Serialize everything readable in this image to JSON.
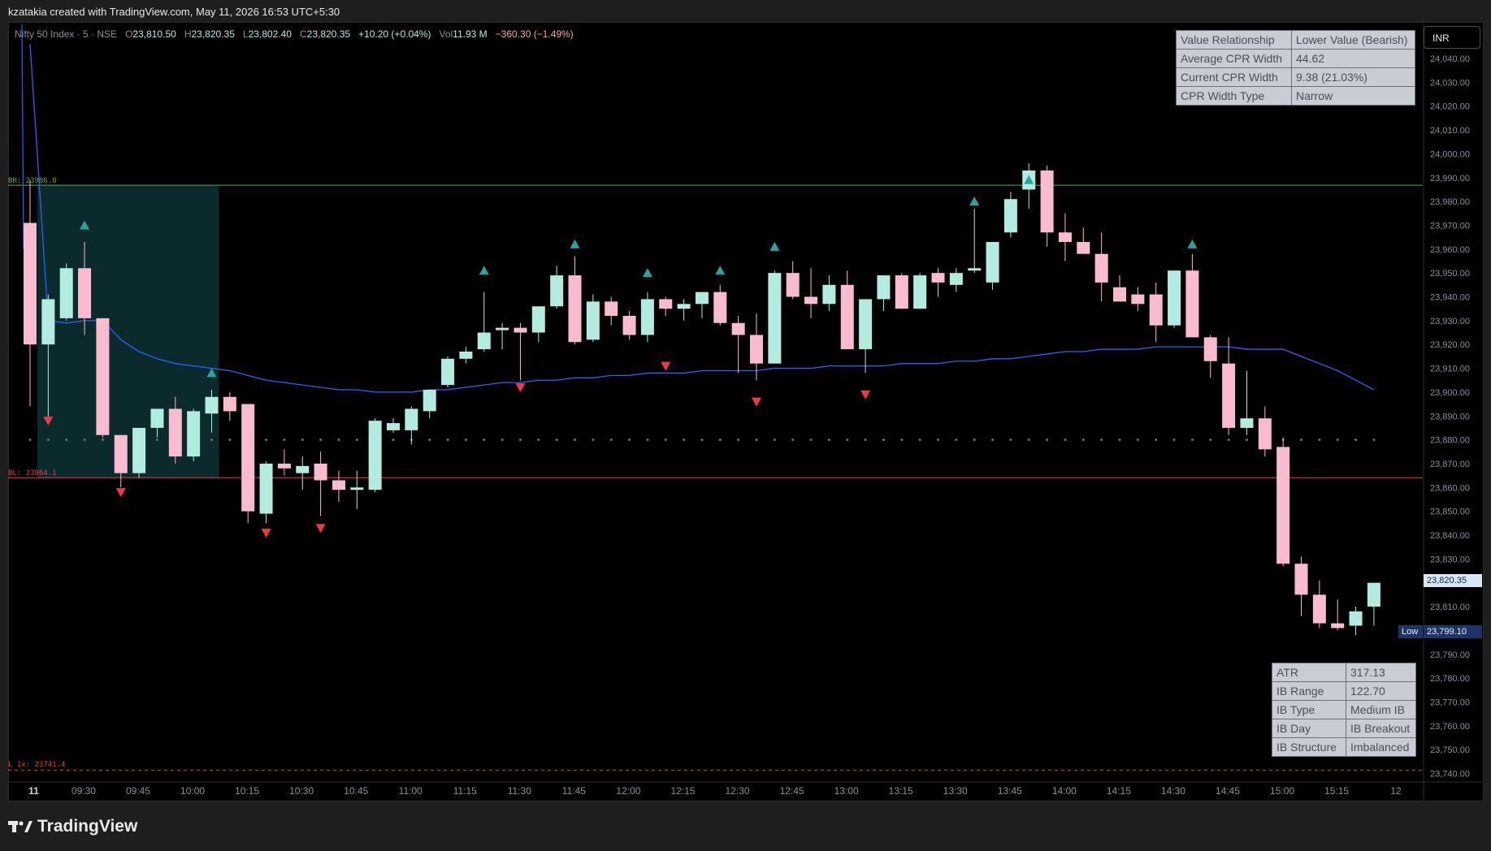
{
  "header": {
    "attribution": "kzatakia created with TradingView.com, May 11, 2026 16:53 UTC+5:30"
  },
  "legend": {
    "symbol": "Nifty 50 Index · 5 · NSE",
    "open_label": "O",
    "open": "23,810.50",
    "high_label": "H",
    "high": "23,820.35",
    "low_label": "L",
    "low": "23,802.40",
    "close_label": "C",
    "close": "23,820.35",
    "change": "+10.20 (+0.04%)",
    "vol_label": "Vol",
    "vol": "11.93 M",
    "vol_change": "−360.30 (−1.49%)"
  },
  "currency": "INR",
  "last_price_tag": "23,820.35",
  "low_tag": {
    "label": "Low",
    "value": "23,799.10"
  },
  "level_labels": {
    "bh": "BH: 23986.8",
    "bl": "BL: 23864.1",
    "l1x": "L 1x: 23741.4"
  },
  "cpr_table": [
    {
      "key": "Value Relationship",
      "value": "Lower Value (Bearish)"
    },
    {
      "key": "Average CPR Width",
      "value": "44.62"
    },
    {
      "key": "Current CPR Width",
      "value": "9.38 (21.03%)"
    },
    {
      "key": "CPR Width Type",
      "value": "Narrow"
    }
  ],
  "ib_table": [
    {
      "key": "ATR",
      "value": "317.13"
    },
    {
      "key": "IB Range",
      "value": "122.70"
    },
    {
      "key": "IB Type",
      "value": "Medium IB"
    },
    {
      "key": "IB Day",
      "value": "IB Breakout"
    },
    {
      "key": "IB Structure",
      "value": "Imbalanced"
    }
  ],
  "brand": "TradingView",
  "colors": {
    "up": "#b2ebe0",
    "down": "#f8bbd0",
    "signal_up": "#26a69a",
    "signal_down": "#f23645",
    "ma_line": "#2962ff",
    "bh_line": "#4caf50",
    "bl_line": "#f23645",
    "ib_zone": "#0a2a2c",
    "pivot_dots": "#6b7078",
    "axis_text": "#8a8e97"
  },
  "chart_data": {
    "type": "candlestick",
    "interval": "5",
    "x_tick_labels": [
      "11",
      "09:30",
      "09:45",
      "10:00",
      "10:15",
      "10:30",
      "10:45",
      "11:00",
      "11:15",
      "11:30",
      "11:45",
      "12:00",
      "12:15",
      "12:30",
      "12:45",
      "13:00",
      "13:15",
      "13:30",
      "13:45",
      "14:00",
      "14:15",
      "14:30",
      "14:45",
      "15:00",
      "15:15",
      "12"
    ],
    "y_range": [
      23735,
      24046
    ],
    "y_ticks": [
      24040,
      24030,
      24020,
      24010,
      24000,
      23990,
      23980,
      23970,
      23960,
      23950,
      23940,
      23930,
      23920,
      23910,
      23900,
      23890,
      23880,
      23870,
      23860,
      23850,
      23840,
      23830,
      23820,
      23810,
      23800,
      23790,
      23780,
      23770,
      23760,
      23750,
      23740
    ],
    "candles": [
      {
        "o": 23971,
        "h": 23989,
        "l": 23894,
        "c": 23920
      },
      {
        "o": 23920,
        "h": 23941,
        "l": 23889,
        "c": 23939
      },
      {
        "o": 23931,
        "h": 23954,
        "l": 23930,
        "c": 23952
      },
      {
        "o": 23952,
        "h": 23963,
        "l": 23924,
        "c": 23931
      },
      {
        "o": 23931,
        "h": 23931,
        "l": 23881,
        "c": 23882
      },
      {
        "o": 23882,
        "h": 23882,
        "l": 23860,
        "c": 23866
      },
      {
        "o": 23866,
        "h": 23885,
        "l": 23864,
        "c": 23885
      },
      {
        "o": 23885,
        "h": 23893,
        "l": 23881,
        "c": 23893
      },
      {
        "o": 23893,
        "h": 23898,
        "l": 23870,
        "c": 23873
      },
      {
        "o": 23873,
        "h": 23893,
        "l": 23871,
        "c": 23892
      },
      {
        "o": 23891,
        "h": 23901,
        "l": 23883,
        "c": 23898
      },
      {
        "o": 23898,
        "h": 23900,
        "l": 23888,
        "c": 23892
      },
      {
        "o": 23895,
        "h": 23895,
        "l": 23845,
        "c": 23850
      },
      {
        "o": 23849,
        "h": 23871,
        "l": 23845,
        "c": 23870
      },
      {
        "o": 23870,
        "h": 23876,
        "l": 23865,
        "c": 23868
      },
      {
        "o": 23866,
        "h": 23873,
        "l": 23859,
        "c": 23869
      },
      {
        "o": 23870,
        "h": 23875,
        "l": 23848,
        "c": 23863
      },
      {
        "o": 23863,
        "h": 23867,
        "l": 23854,
        "c": 23859
      },
      {
        "o": 23859,
        "h": 23867,
        "l": 23851,
        "c": 23860
      },
      {
        "o": 23859,
        "h": 23889,
        "l": 23858,
        "c": 23888
      },
      {
        "o": 23884,
        "h": 23889,
        "l": 23883,
        "c": 23887
      },
      {
        "o": 23884,
        "h": 23894,
        "l": 23878,
        "c": 23893
      },
      {
        "o": 23892,
        "h": 23901,
        "l": 23889,
        "c": 23901
      },
      {
        "o": 23903,
        "h": 23915,
        "l": 23902,
        "c": 23914
      },
      {
        "o": 23914,
        "h": 23919,
        "l": 23912,
        "c": 23917
      },
      {
        "o": 23918,
        "h": 23942,
        "l": 23917,
        "c": 23925
      },
      {
        "o": 23926,
        "h": 23929,
        "l": 23918,
        "c": 23927
      },
      {
        "o": 23927,
        "h": 23929,
        "l": 23905,
        "c": 23925
      },
      {
        "o": 23925,
        "h": 23930,
        "l": 23921,
        "c": 23936
      },
      {
        "o": 23936,
        "h": 23953,
        "l": 23935,
        "c": 23949
      },
      {
        "o": 23949,
        "h": 23957,
        "l": 23920,
        "c": 23921
      },
      {
        "o": 23922,
        "h": 23941,
        "l": 23921,
        "c": 23938
      },
      {
        "o": 23938,
        "h": 23940,
        "l": 23928,
        "c": 23932
      },
      {
        "o": 23932,
        "h": 23934,
        "l": 23922,
        "c": 23924
      },
      {
        "o": 23924,
        "h": 23942,
        "l": 23921,
        "c": 23939
      },
      {
        "o": 23939,
        "h": 23940,
        "l": 23932,
        "c": 23935
      },
      {
        "o": 23935,
        "h": 23939,
        "l": 23930,
        "c": 23937
      },
      {
        "o": 23937,
        "h": 23942,
        "l": 23931,
        "c": 23942
      },
      {
        "o": 23942,
        "h": 23945,
        "l": 23928,
        "c": 23929
      },
      {
        "o": 23929,
        "h": 23932,
        "l": 23908,
        "c": 23924
      },
      {
        "o": 23924,
        "h": 23933,
        "l": 23905,
        "c": 23912
      },
      {
        "o": 23912,
        "h": 23951,
        "l": 23912,
        "c": 23950
      },
      {
        "o": 23950,
        "h": 23955,
        "l": 23939,
        "c": 23940
      },
      {
        "o": 23940,
        "h": 23952,
        "l": 23931,
        "c": 23937
      },
      {
        "o": 23937,
        "h": 23949,
        "l": 23934,
        "c": 23945
      },
      {
        "o": 23945,
        "h": 23951,
        "l": 23918,
        "c": 23918
      },
      {
        "o": 23918,
        "h": 23938,
        "l": 23908,
        "c": 23939
      },
      {
        "o": 23939,
        "h": 23949,
        "l": 23934,
        "c": 23949
      },
      {
        "o": 23949,
        "h": 23950,
        "l": 23935,
        "c": 23935
      },
      {
        "o": 23935,
        "h": 23950,
        "l": 23935,
        "c": 23949
      },
      {
        "o": 23950,
        "h": 23952,
        "l": 23940,
        "c": 23946
      },
      {
        "o": 23945,
        "h": 23952,
        "l": 23942,
        "c": 23950
      },
      {
        "o": 23951,
        "h": 23977,
        "l": 23950,
        "c": 23952
      },
      {
        "o": 23946,
        "h": 23956,
        "l": 23943,
        "c": 23963
      },
      {
        "o": 23967,
        "h": 23984,
        "l": 23965,
        "c": 23981
      },
      {
        "o": 23985,
        "h": 23996,
        "l": 23977,
        "c": 23993
      },
      {
        "o": 23993,
        "h": 23995,
        "l": 23961,
        "c": 23967
      },
      {
        "o": 23967,
        "h": 23975,
        "l": 23955,
        "c": 23963
      },
      {
        "o": 23963,
        "h": 23969,
        "l": 23959,
        "c": 23958
      },
      {
        "o": 23958,
        "h": 23967,
        "l": 23938,
        "c": 23946
      },
      {
        "o": 23944,
        "h": 23949,
        "l": 23940,
        "c": 23938
      },
      {
        "o": 23941,
        "h": 23944,
        "l": 23934,
        "c": 23937
      },
      {
        "o": 23941,
        "h": 23946,
        "l": 23921,
        "c": 23928
      },
      {
        "o": 23928,
        "h": 23951,
        "l": 23927,
        "c": 23951
      },
      {
        "o": 23951,
        "h": 23958,
        "l": 23924,
        "c": 23923
      },
      {
        "o": 23923,
        "h": 23924,
        "l": 23906,
        "c": 23913
      },
      {
        "o": 23912,
        "h": 23923,
        "l": 23882,
        "c": 23885
      },
      {
        "o": 23885,
        "h": 23909,
        "l": 23882,
        "c": 23889
      },
      {
        "o": 23889,
        "h": 23894,
        "l": 23873,
        "c": 23876
      },
      {
        "o": 23877,
        "h": 23881,
        "l": 23827,
        "c": 23828
      },
      {
        "o": 23828,
        "h": 23831,
        "l": 23806,
        "c": 23815
      },
      {
        "o": 23815,
        "h": 23821,
        "l": 23801,
        "c": 23803
      },
      {
        "o": 23803,
        "h": 23813,
        "l": 23800,
        "c": 23801
      },
      {
        "o": 23802,
        "h": 23810,
        "l": 23798,
        "c": 23808
      },
      {
        "o": 23810,
        "h": 23820,
        "l": 23802,
        "c": 23820
      }
    ],
    "ma_line": [
      [
        0,
        24046
      ],
      [
        1,
        23930
      ],
      [
        2,
        23929
      ],
      [
        3,
        23930
      ],
      [
        4,
        23930
      ],
      [
        5,
        23922
      ],
      [
        6,
        23917
      ],
      [
        7,
        23914
      ],
      [
        8,
        23912
      ],
      [
        9,
        23911
      ],
      [
        10,
        23910
      ],
      [
        11,
        23909
      ],
      [
        12,
        23907
      ],
      [
        13,
        23905
      ],
      [
        14,
        23904
      ],
      [
        15,
        23903
      ],
      [
        16,
        23902
      ],
      [
        17,
        23901
      ],
      [
        18,
        23901
      ],
      [
        19,
        23900
      ],
      [
        20,
        23900
      ],
      [
        21,
        23900
      ],
      [
        22,
        23901
      ],
      [
        23,
        23901
      ],
      [
        24,
        23902
      ],
      [
        25,
        23903
      ],
      [
        26,
        23904
      ],
      [
        27,
        23904
      ],
      [
        28,
        23905
      ],
      [
        29,
        23905
      ],
      [
        30,
        23906
      ],
      [
        31,
        23906
      ],
      [
        32,
        23907
      ],
      [
        33,
        23907
      ],
      [
        34,
        23908
      ],
      [
        35,
        23908
      ],
      [
        36,
        23908
      ],
      [
        37,
        23909
      ],
      [
        38,
        23909
      ],
      [
        39,
        23909
      ],
      [
        40,
        23909
      ],
      [
        41,
        23910
      ],
      [
        42,
        23910
      ],
      [
        43,
        23910
      ],
      [
        44,
        23911
      ],
      [
        45,
        23911
      ],
      [
        46,
        23911
      ],
      [
        47,
        23911
      ],
      [
        48,
        23912
      ],
      [
        49,
        23912
      ],
      [
        50,
        23912
      ],
      [
        51,
        23913
      ],
      [
        52,
        23913
      ],
      [
        53,
        23914
      ],
      [
        54,
        23914
      ],
      [
        55,
        23915
      ],
      [
        56,
        23916
      ],
      [
        57,
        23917
      ],
      [
        58,
        23917
      ],
      [
        59,
        23918
      ],
      [
        60,
        23918
      ],
      [
        61,
        23918
      ],
      [
        62,
        23919
      ],
      [
        63,
        23919
      ],
      [
        64,
        23919
      ],
      [
        65,
        23919
      ],
      [
        66,
        23919
      ],
      [
        67,
        23918
      ],
      [
        68,
        23918
      ],
      [
        69,
        23918
      ],
      [
        70,
        23915
      ],
      [
        71,
        23912
      ],
      [
        72,
        23909
      ],
      [
        73,
        23905
      ],
      [
        74,
        23901
      ]
    ],
    "levels": {
      "bh": 23986.8,
      "bl": 23864.1,
      "l1x": 23741.4,
      "pivot": 23880
    },
    "signals_up": [
      [
        3,
        23970
      ],
      [
        10,
        23908
      ],
      [
        25,
        23951
      ],
      [
        30,
        23962
      ],
      [
        34,
        23950
      ],
      [
        38,
        23951
      ],
      [
        41,
        23961
      ],
      [
        52,
        23980
      ],
      [
        55,
        23989
      ],
      [
        64,
        23962
      ]
    ],
    "signals_down": [
      [
        1,
        23888
      ],
      [
        5,
        23858
      ],
      [
        13,
        23841
      ],
      [
        16,
        23843
      ],
      [
        27,
        23902
      ],
      [
        35,
        23911
      ],
      [
        40,
        23896
      ],
      [
        46,
        23899
      ]
    ]
  }
}
